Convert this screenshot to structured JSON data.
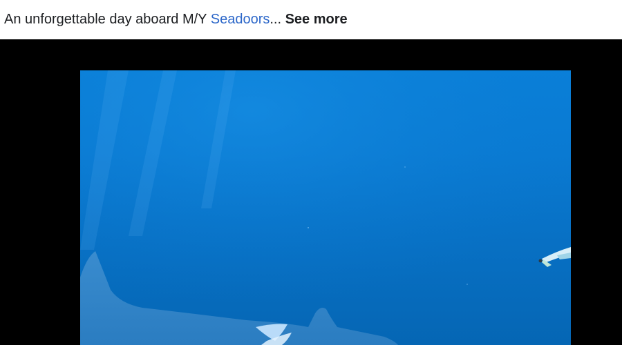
{
  "post": {
    "caption_prefix": "An unforgettable day aboard M/Y ",
    "caption_tag": "Seadoors",
    "caption_ellipsis": "...",
    "see_more_label": "See more"
  },
  "video": {
    "scene": "underwater-whale-shark-with-diver",
    "colors": {
      "water": "#0a7fd8",
      "frame": "#000000",
      "link": "#2c67c9"
    }
  }
}
